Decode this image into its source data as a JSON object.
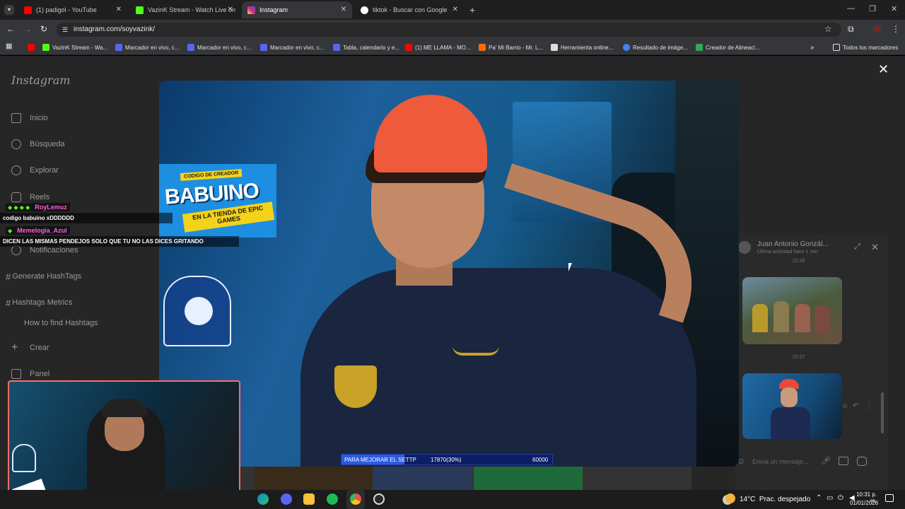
{
  "browser": {
    "tabs": [
      {
        "label": "(1) padigol - YouTube",
        "color": "#ff0000"
      },
      {
        "label": "VazinK Stream - Watch Live on",
        "color": "#53fc18"
      },
      {
        "label": "Instagram",
        "color": "#d62976",
        "active": true
      },
      {
        "label": "tiktok - Buscar con Google",
        "color": "#4285f4"
      }
    ],
    "url": "instagram.com/soyvazink/",
    "bookmarks": [
      {
        "label": "",
        "color": "#ff0000"
      },
      {
        "label": "VazinK Stream - Wa...",
        "color": "#53fc18"
      },
      {
        "label": "Marcador en vivo, c...",
        "color": "#5865f2"
      },
      {
        "label": "Marcador en vivo, c...",
        "color": "#5865f2"
      },
      {
        "label": "Marcador en vivo, c...",
        "color": "#5865f2"
      },
      {
        "label": "Tabla, calendario y e...",
        "color": "#5865f2"
      },
      {
        "label": "(1) ME LLAMA - MO...",
        "color": "#ff0000"
      },
      {
        "label": "Pa' Mi Barrio - Mr. L...",
        "color": "#ff6d00"
      },
      {
        "label": "Herramienta online...",
        "color": "#dddddd"
      },
      {
        "label": "Resultado de imáge...",
        "color": "#4285f4"
      },
      {
        "label": "Creador de Alineaci...",
        "color": "#34a853"
      }
    ],
    "all_bookmarks": "Todos los marcadores"
  },
  "instagram": {
    "logo": "Instagram",
    "nav": [
      "Inicio",
      "Búsqueda",
      "Explorar",
      "Reels",
      "Notificaciones",
      "Crear",
      "Panel"
    ],
    "ext_nav": [
      "Generate HashTags",
      "Hashtags Metrics",
      "How to find Hashtags"
    ],
    "dm": {
      "name": "Juan Antonio Gonzál...",
      "status": "Última actividad hace 1 min",
      "time1": "22:26",
      "time2": "22:27",
      "input_placeholder": "Envía un mensaje..."
    }
  },
  "stream": {
    "creator_code_top": "CODIGO DE CREADOR",
    "creator_code_name": "BABUINO",
    "creator_code_sub": "EN LA TIENDA DE EPIC GAMES",
    "goal_label": "PARA MEJORAR EL SETTP",
    "goal_value": "17870(30%)",
    "goal_target": "60000",
    "goal_progress": 0.3,
    "chat": [
      {
        "user": "RoyLemuz",
        "user_color": "#ff5ce1",
        "message": "codigo babuino xDDDDDD"
      },
      {
        "user": "Memelogia_Azul",
        "user_color": "#ff5ce1",
        "message": "DICEN LAS MISMAS PENDEJOS SOLO QUE TU NO LAS DICES GRITANDO"
      }
    ]
  },
  "taskbar": {
    "weather": "14°C  Prac. despejado",
    "time": "10:31 p. m.",
    "date": "01/01/2026"
  }
}
